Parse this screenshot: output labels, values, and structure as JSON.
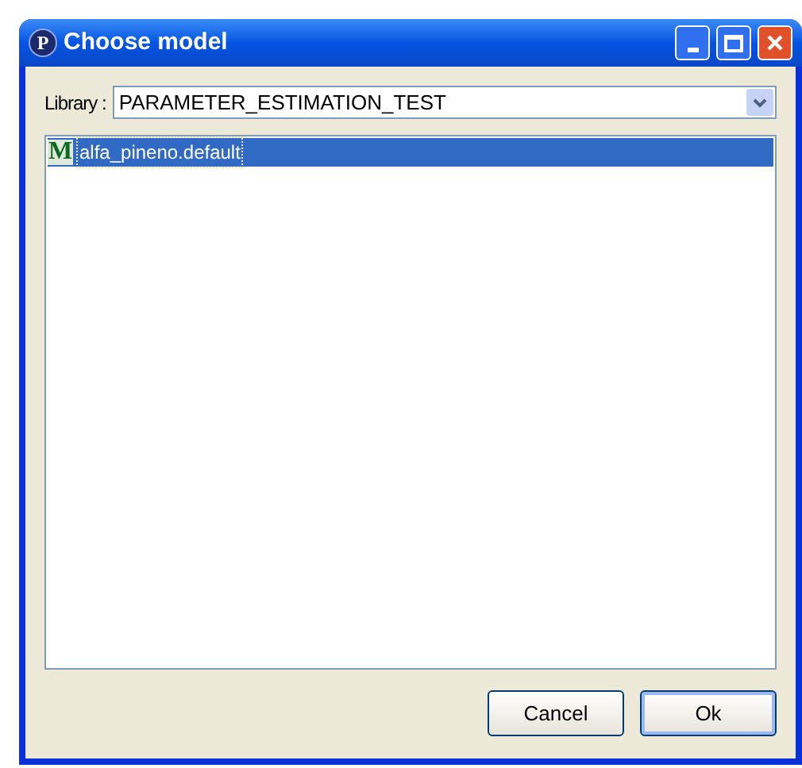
{
  "window": {
    "logo": "P",
    "title": "Choose model"
  },
  "library": {
    "label": "Library :",
    "value": "PARAMETER_ESTIMATION_TEST"
  },
  "models": [
    {
      "icon": "M",
      "label": "alfa_pineno.default",
      "selected": true
    }
  ],
  "buttons": [
    {
      "label": "Cancel",
      "default": false
    },
    {
      "label": "Ok",
      "default": true
    }
  ]
}
